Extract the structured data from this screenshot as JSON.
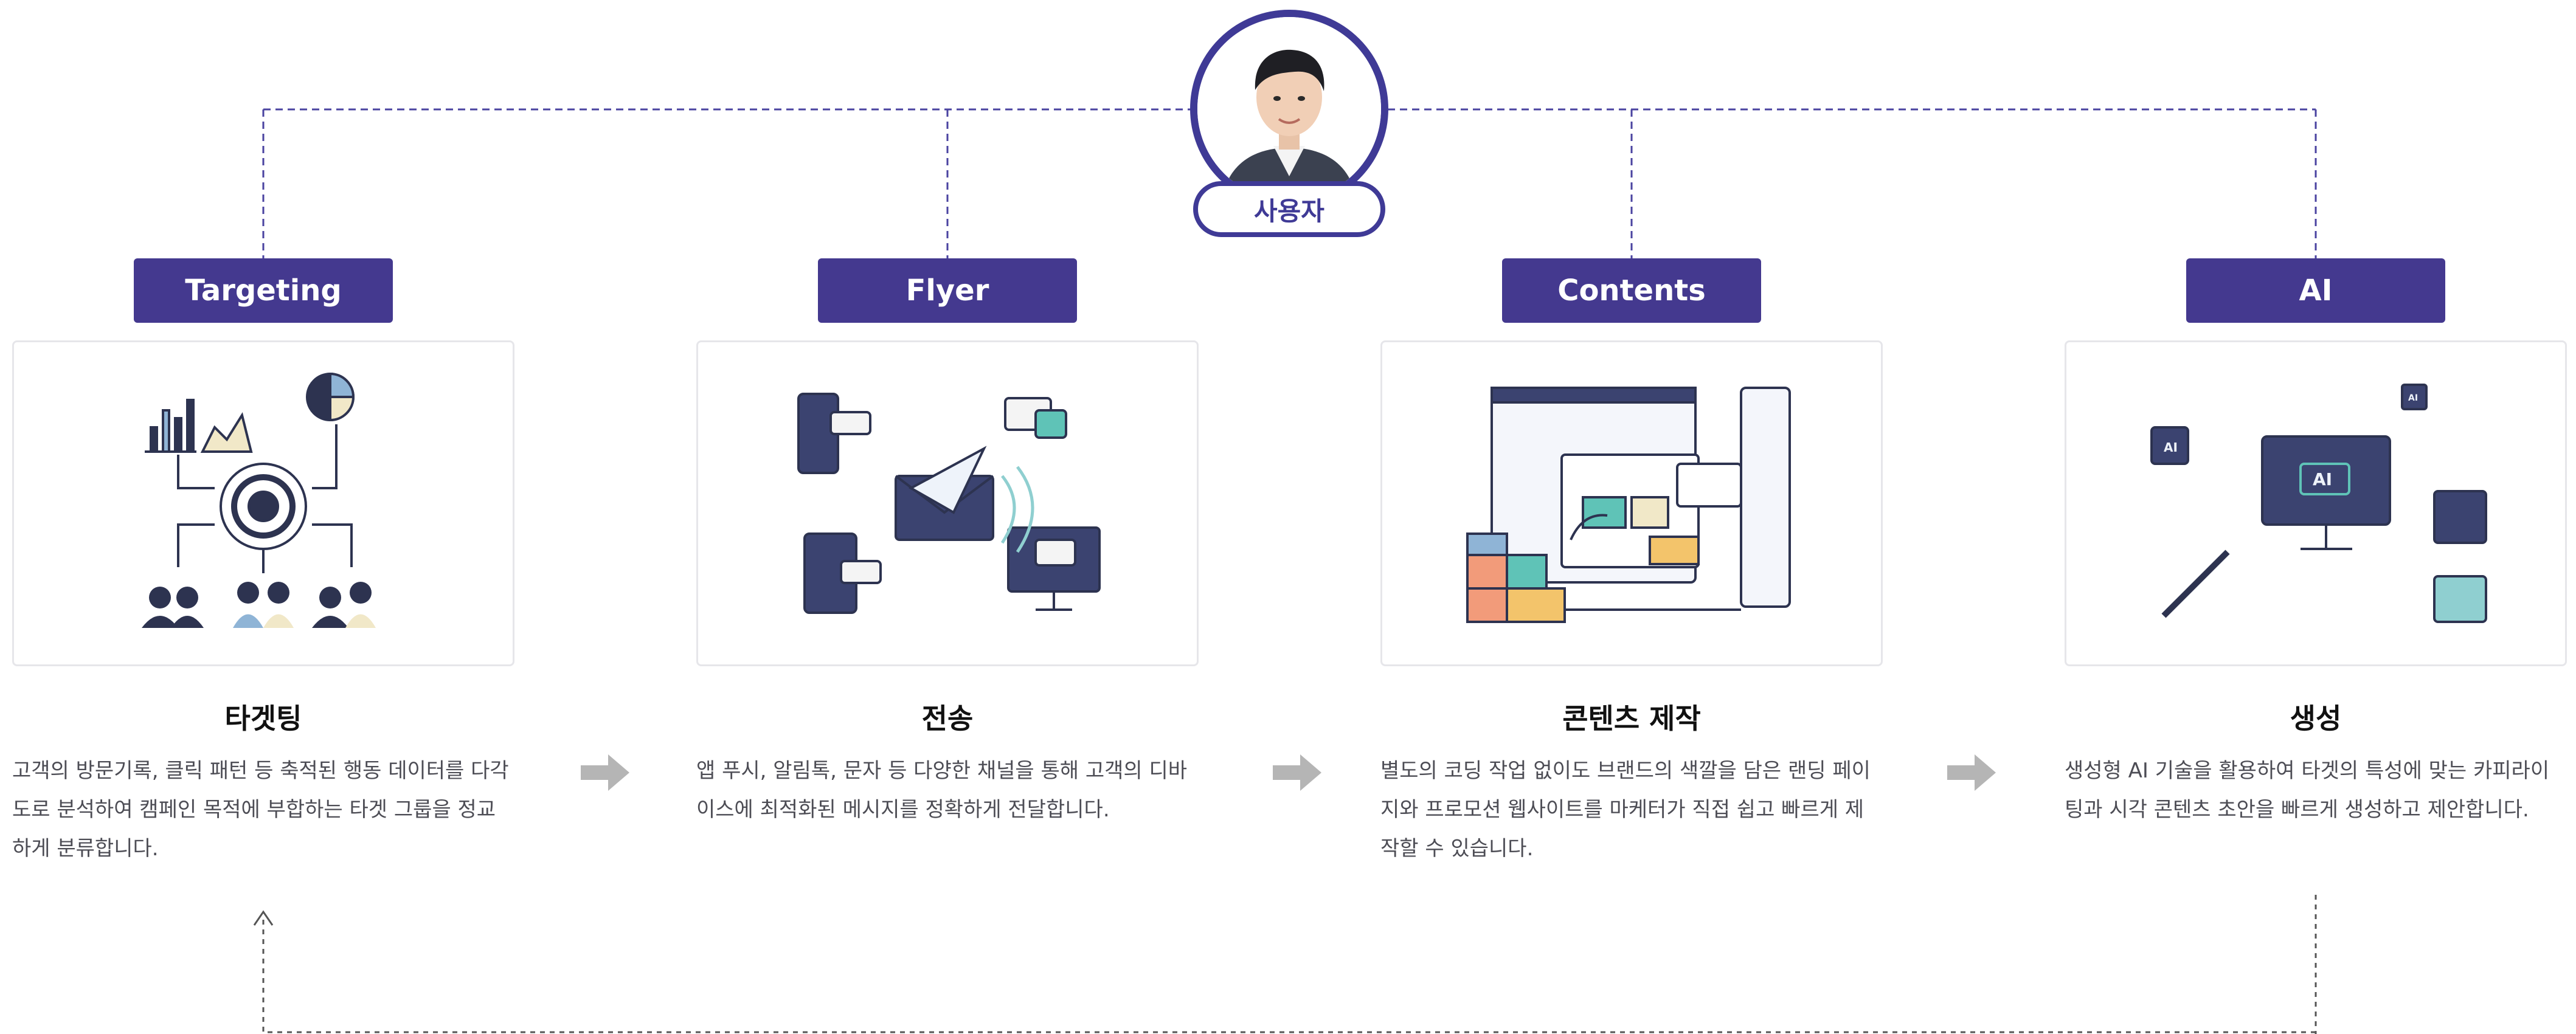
{
  "user": {
    "label": "사용자",
    "icon": "user-avatar"
  },
  "stages": [
    {
      "tab": "Targeting",
      "title": "타겟팅",
      "description": "고객의 방문기록, 클릭 패턴 등 축적된 행동 데이터를 다각도로 분석하여 캠페인 목적에 부합하는 타겟 그룹을 정교하게 분류합니다.",
      "icon": "target-audience-illustration"
    },
    {
      "tab": "Flyer",
      "title": "전송",
      "description": "앱 푸시, 알림톡, 문자 등 다양한 채널을 통해 고객의 디바이스에 최적화된 메시지를 정확하게 전달합니다.",
      "icon": "message-sending-illustration"
    },
    {
      "tab": "Contents",
      "title": "콘텐츠 제작",
      "description": "별도의 코딩 작업 없이도 브랜드의 색깔을 담은 랜딩 페이지와 프로모션 웹사이트를 마케터가 직접 쉽고 빠르게 제작할 수 있습니다.",
      "icon": "content-builder-illustration"
    },
    {
      "tab": "AI",
      "title": "생성",
      "description": "생성형 AI 기술을 활용하여 타겟의 특성에 맞는 카피라이팅과 시각 콘텐츠 초안을 빠르게 생성하고 제안합니다.",
      "icon": "ai-generation-illustration"
    }
  ],
  "colors": {
    "accent": "#44398f",
    "border": "#3f3a96",
    "arrow": "#b5b5b5"
  }
}
